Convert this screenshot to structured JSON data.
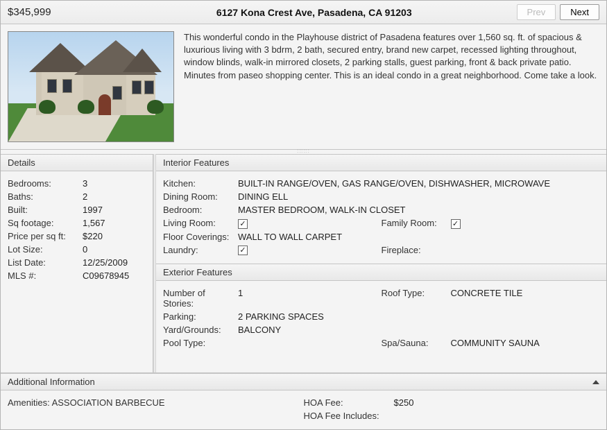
{
  "header": {
    "price": "$345,999",
    "address": "6127 Kona Crest Ave, Pasadena, CA 91203",
    "prev": "Prev",
    "next": "Next"
  },
  "description": "This wonderful condo in the Playhouse district of Pasadena features over 1,560 sq. ft. of spacious & luxurious living with 3 bdrm, 2 bath, secured entry, brand new carpet, recessed lighting throughout, window blinds, walk-in mirrored closets, 2 parking stalls, guest parking, front & back private patio. Minutes from paseo shopping center. This is an ideal condo in a great neighborhood. Come take a look.",
  "details": {
    "heading": "Details",
    "bedrooms_l": "Bedrooms:",
    "bedrooms_v": "3",
    "baths_l": "Baths:",
    "baths_v": "2",
    "built_l": "Built:",
    "built_v": "1997",
    "sqft_l": "Sq footage:",
    "sqft_v": "1,567",
    "ppsf_l": "Price per sq ft:",
    "ppsf_v": "$220",
    "lot_l": "Lot Size:",
    "lot_v": "0",
    "date_l": "List Date:",
    "date_v": "12/25/2009",
    "mls_l": "MLS #:",
    "mls_v": "C09678945"
  },
  "interior": {
    "heading": "Interior Features",
    "kitchen_l": "Kitchen:",
    "kitchen_v": "BUILT-IN RANGE/OVEN, GAS RANGE/OVEN, DISHWASHER, MICROWAVE",
    "dining_l": "Dining Room:",
    "dining_v": "DINING ELL",
    "bedroom_l": "Bedroom:",
    "bedroom_v": "MASTER BEDROOM, WALK-IN CLOSET",
    "living_l": "Living Room:",
    "family_l": "Family Room:",
    "floor_l": "Floor Coverings:",
    "floor_v": "WALL TO WALL CARPET",
    "laundry_l": "Laundry:",
    "fireplace_l": "Fireplace:",
    "check": "✓"
  },
  "exterior": {
    "heading": "Exterior Features",
    "stories_l": "Number of Stories:",
    "stories_v": "1",
    "roof_l": "Roof Type:",
    "roof_v": "CONCRETE TILE",
    "parking_l": "Parking:",
    "parking_v": "2 PARKING SPACES",
    "yard_l": "Yard/Grounds:",
    "yard_v": "BALCONY",
    "pool_l": "Pool Type:",
    "pool_v": "",
    "spa_l": "Spa/Sauna:",
    "spa_v": "COMMUNITY SAUNA"
  },
  "additional": {
    "heading": "Additional Information",
    "amen_full": "Amenities: ASSOCIATION BARBECUE",
    "hoa_l": "HOA Fee:",
    "hoa_v": "$250",
    "hoainc_l": "HOA Fee Includes:",
    "hoainc_v": ""
  }
}
